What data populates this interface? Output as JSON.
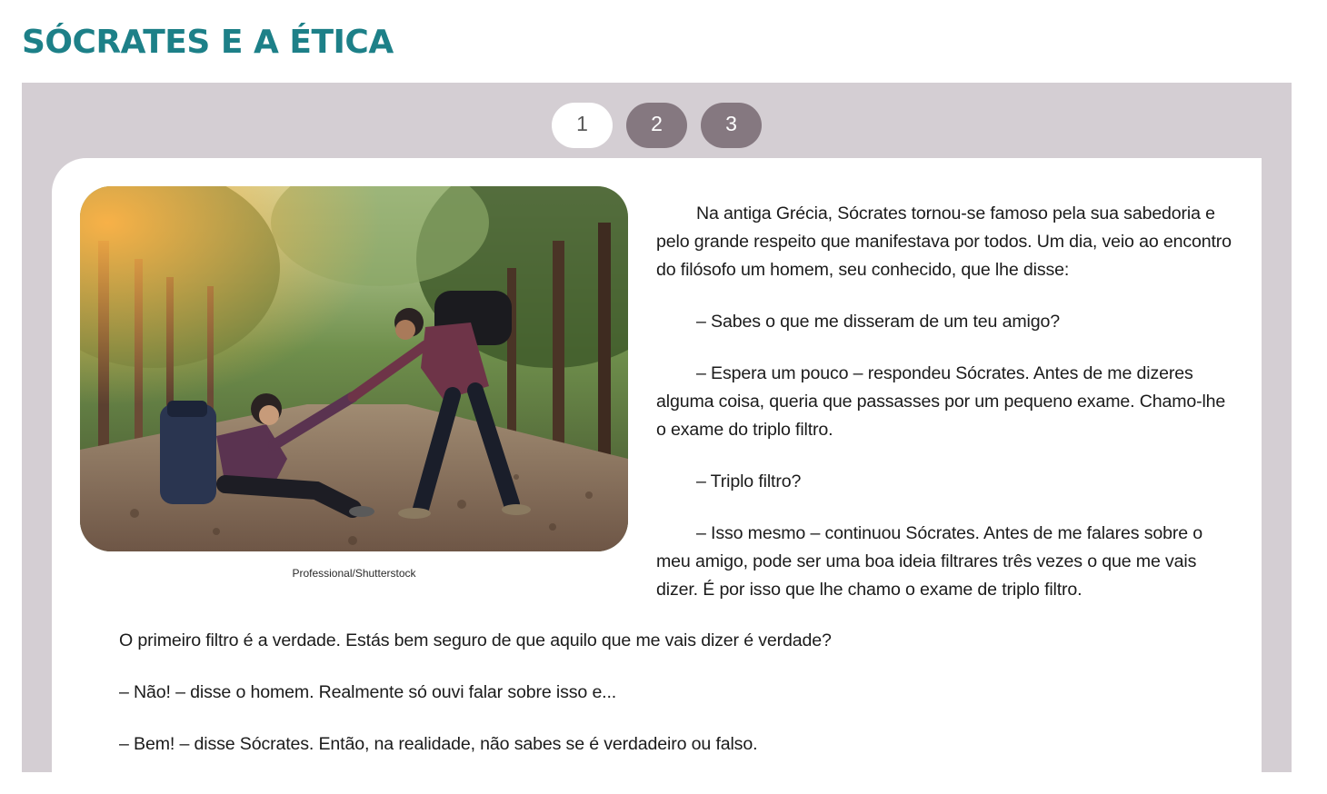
{
  "title": "SÓCRATES E A ÉTICA",
  "pagination": {
    "pages": [
      "1",
      "2",
      "3"
    ],
    "active": "1"
  },
  "image": {
    "credit": "Professional/Shutterstock"
  },
  "story": {
    "paragraphs_beside_image": [
      "Na antiga Grécia, Sócrates tornou-se famoso pela sua sabedoria e pelo grande respeito que manifestava por todos. Um dia, veio ao encontro do filósofo um homem, seu conhecido, que lhe disse:",
      "– Sabes o que me disseram de um teu amigo?",
      "– Espera um pouco – respondeu Sócrates. Antes de me dizeres alguma coisa, queria que passasses por um pequeno exame. Chamo-lhe o exame do triplo filtro.",
      "– Triplo filtro?",
      "– Isso mesmo – continuou Sócrates. Antes de me falares sobre o meu amigo, pode ser uma boa ideia filtrares três vezes o que me vais dizer. É por isso que lhe chamo o exame de triplo filtro."
    ],
    "paragraphs_full_width": [
      "O primeiro filtro é a verdade. Estás bem seguro de que aquilo que me vais dizer é verdade?",
      "– Não! – disse o homem. Realmente só ouvi falar sobre isso e...",
      "– Bem! – disse Sócrates. Então, na realidade, não sabes se é verdadeiro ou falso."
    ]
  },
  "colors": {
    "title": "#1d8088",
    "panel": "#d4ced3",
    "page_button": "#857880",
    "page_button_active": "#ffffff"
  }
}
